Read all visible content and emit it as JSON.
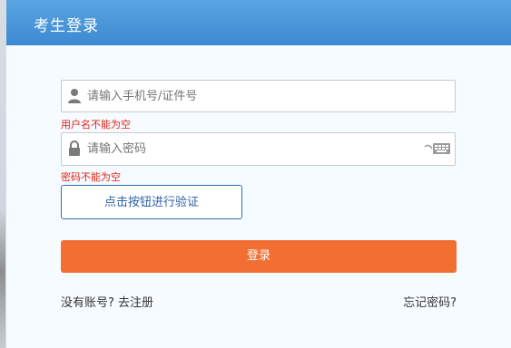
{
  "header": {
    "title": "考生登录"
  },
  "form": {
    "username_placeholder": "请输入手机号/证件号",
    "username_error": "用户名不能为空",
    "password_placeholder": "请输入密码",
    "password_error": "密码不能为空",
    "verify_label": "点击按钮进行验证",
    "login_label": "登录"
  },
  "links": {
    "no_account": "没有账号?",
    "register": "去注册",
    "forgot": "忘记密码?"
  },
  "colors": {
    "header": "#4a95d9",
    "login_button": "#f26f34",
    "error": "#e2231a",
    "verify_border": "#2f6fb8"
  },
  "icons": [
    "user-icon",
    "lock-icon",
    "keyboard-icon"
  ]
}
